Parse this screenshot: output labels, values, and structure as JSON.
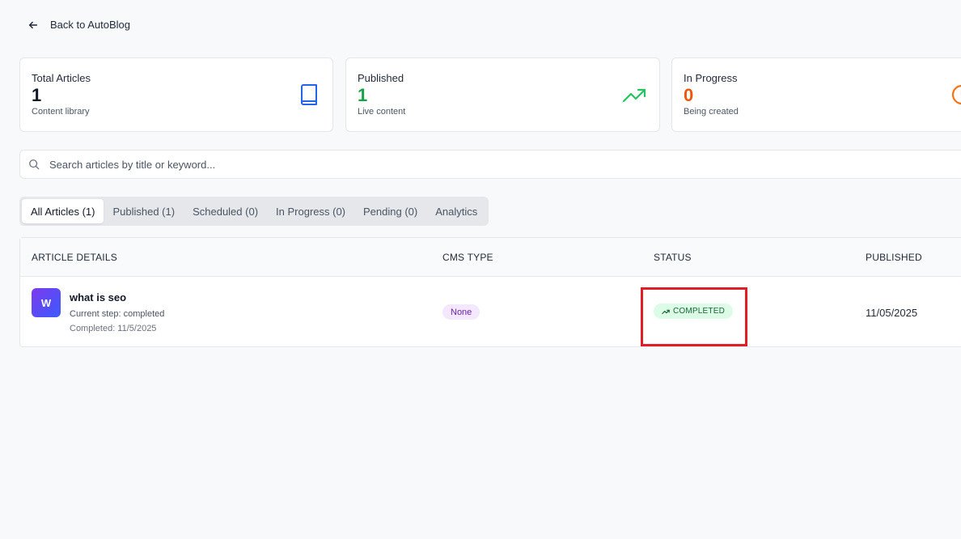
{
  "nav": {
    "back_label": "Back to AutoBlog"
  },
  "stats": [
    {
      "label": "Total Articles",
      "value": "1",
      "sub": "Content library",
      "color": "#111827",
      "icon": "book-icon"
    },
    {
      "label": "Published",
      "value": "1",
      "sub": "Live content",
      "color": "#16a34a",
      "icon": "trending-up-icon"
    },
    {
      "label": "In Progress",
      "value": "0",
      "sub": "Being created",
      "color": "#ea580c",
      "icon": "clock-icon"
    }
  ],
  "search": {
    "placeholder": "Search articles by title or keyword..."
  },
  "tabs": [
    {
      "label": "All Articles (1)",
      "active": true
    },
    {
      "label": "Published (1)"
    },
    {
      "label": "Scheduled (0)"
    },
    {
      "label": "In Progress (0)"
    },
    {
      "label": "Pending (0)"
    },
    {
      "label": "Analytics"
    }
  ],
  "table": {
    "headers": [
      "ARTICLE DETAILS",
      "CMS TYPE",
      "STATUS",
      "PUBLISHED"
    ],
    "rows": [
      {
        "avatar": "W",
        "title": "what is seo",
        "step": "Current step: completed",
        "completed": "Completed: 11/5/2025",
        "cms": "None",
        "status": "COMPLETED",
        "published": "11/05/2025"
      }
    ]
  }
}
